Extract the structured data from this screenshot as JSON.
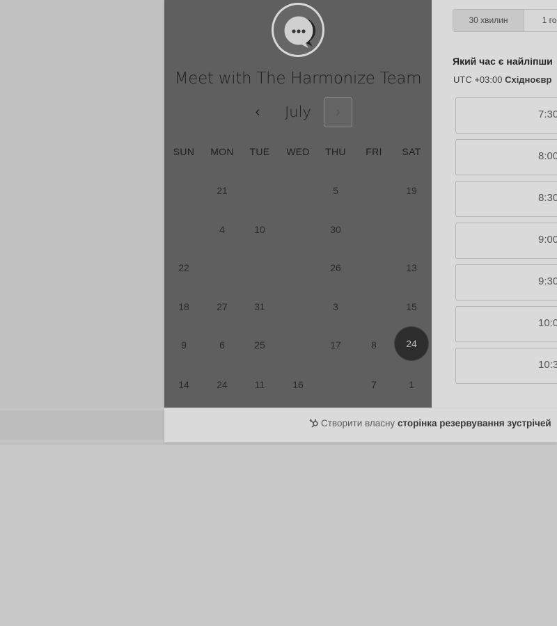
{
  "header": {
    "title": "Meet with The Harmonize Team"
  },
  "calendar": {
    "month": "July",
    "weekdays": [
      "SUN",
      "MON",
      "TUE",
      "WED",
      "THU",
      "FRI",
      "SAT"
    ],
    "days": [
      {
        "label": "21",
        "col": 1,
        "row": 0
      },
      {
        "label": "5",
        "col": 4,
        "row": 0
      },
      {
        "label": "19",
        "col": 6,
        "row": 0
      },
      {
        "label": "4",
        "col": 1,
        "row": 1
      },
      {
        "label": "10",
        "col": 2,
        "row": 1
      },
      {
        "label": "30",
        "col": 4,
        "row": 1
      },
      {
        "label": "22",
        "col": 0,
        "row": 2
      },
      {
        "label": "26",
        "col": 4,
        "row": 2
      },
      {
        "label": "13",
        "col": 6,
        "row": 2
      },
      {
        "label": "18",
        "col": 0,
        "row": 3
      },
      {
        "label": "27",
        "col": 1,
        "row": 3
      },
      {
        "label": "31",
        "col": 2,
        "row": 3
      },
      {
        "label": "3",
        "col": 4,
        "row": 3
      },
      {
        "label": "15",
        "col": 6,
        "row": 3
      },
      {
        "label": "9",
        "col": 0,
        "row": 4
      },
      {
        "label": "6",
        "col": 1,
        "row": 4
      },
      {
        "label": "25",
        "col": 2,
        "row": 4
      },
      {
        "label": "17",
        "col": 4,
        "row": 4
      },
      {
        "label": "8",
        "col": 5,
        "row": 4
      },
      {
        "label": "24",
        "col": 6,
        "row": 4,
        "selected": true
      },
      {
        "label": "14",
        "col": 0,
        "row": 5
      },
      {
        "label": "24",
        "col": 1,
        "row": 5
      },
      {
        "label": "11",
        "col": 2,
        "row": 5
      },
      {
        "label": "16",
        "col": 3,
        "row": 5
      },
      {
        "label": "7",
        "col": 5,
        "row": 5
      },
      {
        "label": "1",
        "col": 6,
        "row": 5
      }
    ]
  },
  "booking": {
    "durations": [
      "30 хвилин",
      "1 го"
    ],
    "question": "Який час є найліпши",
    "timezone_prefix": "UTC +03:00",
    "timezone_name": "Східноєвр",
    "slots": [
      "7:30",
      "8:00",
      "8:30",
      "9:00",
      "9:30",
      "10:0",
      "10:3"
    ]
  },
  "footer": {
    "text": "Створити власну",
    "link": "сторінка резервування зустрічей"
  },
  "icons": {
    "avatar": "chat-bubble-icon",
    "prev": "chevron-left-icon",
    "next": "chevron-right-icon",
    "footer": "sprocket-icon"
  }
}
